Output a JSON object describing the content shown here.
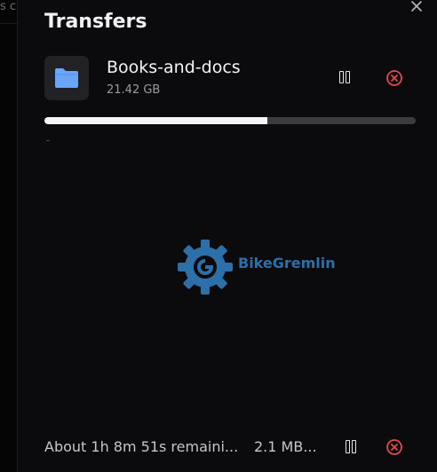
{
  "background_app": {
    "partial_text": "s c"
  },
  "panel": {
    "title": "Transfers",
    "close_icon": "close-icon"
  },
  "transfer": {
    "name": "Books-and-docs",
    "size": "21.42 GB",
    "progress": 0.6,
    "thumbnail_icon": "folder-icon",
    "pause_icon": "pause-icon",
    "cancel_icon": "cancel-circle-icon"
  },
  "watermark": {
    "text": "BikeGremlin"
  },
  "footer": {
    "status": "About 1h 8m 51s remaini...",
    "rate": "2.1 MB...",
    "pause_icon": "pause-icon",
    "cancel_icon": "cancel-circle-icon"
  },
  "colors": {
    "background": "#0b0b0e",
    "accent_cancel": "#e5484d",
    "folder_blue": "#6aa6f8",
    "progress_fill": "#f5f5f7",
    "progress_track": "#3b3b40",
    "watermark_blue": "#2d6fa8"
  }
}
